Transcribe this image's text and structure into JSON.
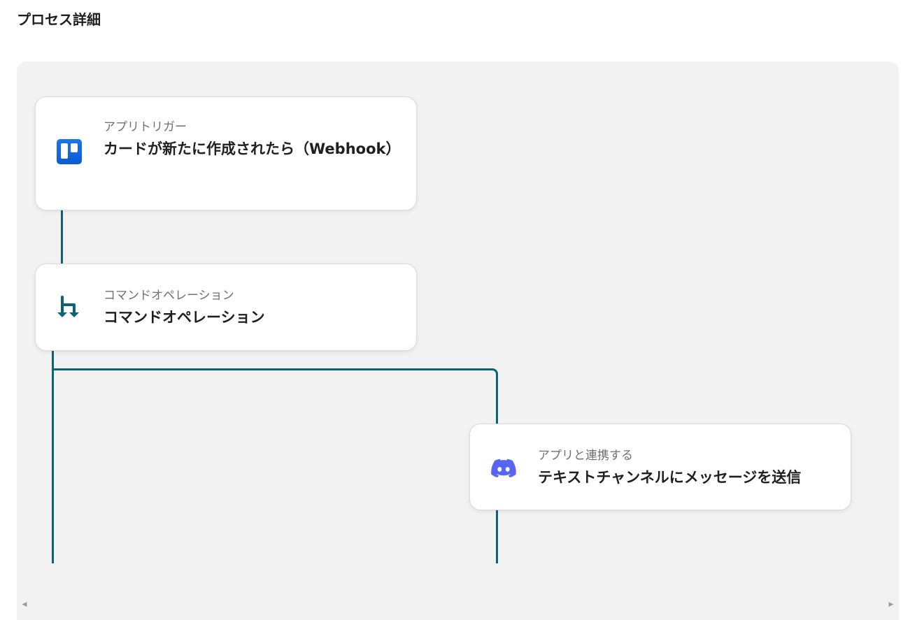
{
  "page": {
    "title": "プロセス詳細"
  },
  "steps": [
    {
      "label": "アプリトリガー",
      "title": "カードが新たに作成されたら（Webhook）",
      "icon": "trello-icon"
    },
    {
      "label": "コマンドオペレーション",
      "title": "コマンドオペレーション",
      "icon": "command-branch-icon"
    },
    {
      "label": "アプリと連携する",
      "title": "テキストチャンネルにメッセージを送信",
      "icon": "discord-icon"
    }
  ],
  "colors": {
    "connector": "#0d6375",
    "canvas_bg": "#f2f2f2",
    "trello_blue": "#0c66e4",
    "discord_purple": "#5865f2"
  }
}
